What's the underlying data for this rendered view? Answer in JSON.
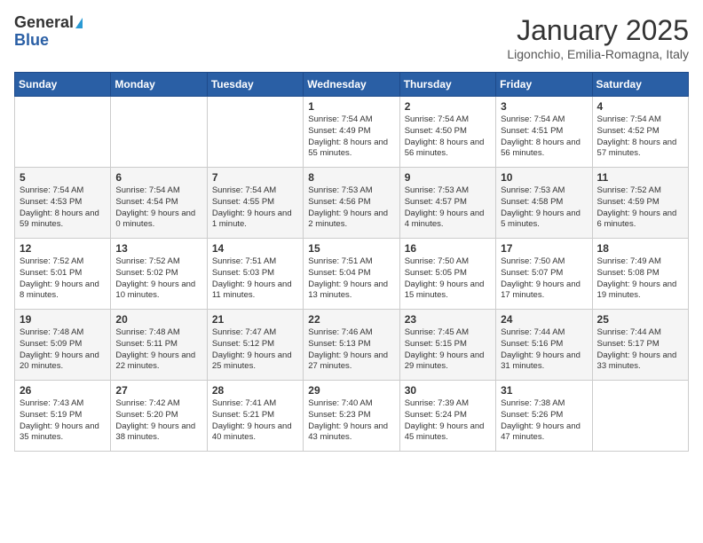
{
  "header": {
    "logo_general": "General",
    "logo_blue": "Blue",
    "month_title": "January 2025",
    "location": "Ligonchio, Emilia-Romagna, Italy"
  },
  "days_of_week": [
    "Sunday",
    "Monday",
    "Tuesday",
    "Wednesday",
    "Thursday",
    "Friday",
    "Saturday"
  ],
  "weeks": [
    [
      {
        "day": "",
        "content": ""
      },
      {
        "day": "",
        "content": ""
      },
      {
        "day": "",
        "content": ""
      },
      {
        "day": "1",
        "content": "Sunrise: 7:54 AM\nSunset: 4:49 PM\nDaylight: 8 hours and 55 minutes."
      },
      {
        "day": "2",
        "content": "Sunrise: 7:54 AM\nSunset: 4:50 PM\nDaylight: 8 hours and 56 minutes."
      },
      {
        "day": "3",
        "content": "Sunrise: 7:54 AM\nSunset: 4:51 PM\nDaylight: 8 hours and 56 minutes."
      },
      {
        "day": "4",
        "content": "Sunrise: 7:54 AM\nSunset: 4:52 PM\nDaylight: 8 hours and 57 minutes."
      }
    ],
    [
      {
        "day": "5",
        "content": "Sunrise: 7:54 AM\nSunset: 4:53 PM\nDaylight: 8 hours and 59 minutes."
      },
      {
        "day": "6",
        "content": "Sunrise: 7:54 AM\nSunset: 4:54 PM\nDaylight: 9 hours and 0 minutes."
      },
      {
        "day": "7",
        "content": "Sunrise: 7:54 AM\nSunset: 4:55 PM\nDaylight: 9 hours and 1 minute."
      },
      {
        "day": "8",
        "content": "Sunrise: 7:53 AM\nSunset: 4:56 PM\nDaylight: 9 hours and 2 minutes."
      },
      {
        "day": "9",
        "content": "Sunrise: 7:53 AM\nSunset: 4:57 PM\nDaylight: 9 hours and 4 minutes."
      },
      {
        "day": "10",
        "content": "Sunrise: 7:53 AM\nSunset: 4:58 PM\nDaylight: 9 hours and 5 minutes."
      },
      {
        "day": "11",
        "content": "Sunrise: 7:52 AM\nSunset: 4:59 PM\nDaylight: 9 hours and 6 minutes."
      }
    ],
    [
      {
        "day": "12",
        "content": "Sunrise: 7:52 AM\nSunset: 5:01 PM\nDaylight: 9 hours and 8 minutes."
      },
      {
        "day": "13",
        "content": "Sunrise: 7:52 AM\nSunset: 5:02 PM\nDaylight: 9 hours and 10 minutes."
      },
      {
        "day": "14",
        "content": "Sunrise: 7:51 AM\nSunset: 5:03 PM\nDaylight: 9 hours and 11 minutes."
      },
      {
        "day": "15",
        "content": "Sunrise: 7:51 AM\nSunset: 5:04 PM\nDaylight: 9 hours and 13 minutes."
      },
      {
        "day": "16",
        "content": "Sunrise: 7:50 AM\nSunset: 5:05 PM\nDaylight: 9 hours and 15 minutes."
      },
      {
        "day": "17",
        "content": "Sunrise: 7:50 AM\nSunset: 5:07 PM\nDaylight: 9 hours and 17 minutes."
      },
      {
        "day": "18",
        "content": "Sunrise: 7:49 AM\nSunset: 5:08 PM\nDaylight: 9 hours and 19 minutes."
      }
    ],
    [
      {
        "day": "19",
        "content": "Sunrise: 7:48 AM\nSunset: 5:09 PM\nDaylight: 9 hours and 20 minutes."
      },
      {
        "day": "20",
        "content": "Sunrise: 7:48 AM\nSunset: 5:11 PM\nDaylight: 9 hours and 22 minutes."
      },
      {
        "day": "21",
        "content": "Sunrise: 7:47 AM\nSunset: 5:12 PM\nDaylight: 9 hours and 25 minutes."
      },
      {
        "day": "22",
        "content": "Sunrise: 7:46 AM\nSunset: 5:13 PM\nDaylight: 9 hours and 27 minutes."
      },
      {
        "day": "23",
        "content": "Sunrise: 7:45 AM\nSunset: 5:15 PM\nDaylight: 9 hours and 29 minutes."
      },
      {
        "day": "24",
        "content": "Sunrise: 7:44 AM\nSunset: 5:16 PM\nDaylight: 9 hours and 31 minutes."
      },
      {
        "day": "25",
        "content": "Sunrise: 7:44 AM\nSunset: 5:17 PM\nDaylight: 9 hours and 33 minutes."
      }
    ],
    [
      {
        "day": "26",
        "content": "Sunrise: 7:43 AM\nSunset: 5:19 PM\nDaylight: 9 hours and 35 minutes."
      },
      {
        "day": "27",
        "content": "Sunrise: 7:42 AM\nSunset: 5:20 PM\nDaylight: 9 hours and 38 minutes."
      },
      {
        "day": "28",
        "content": "Sunrise: 7:41 AM\nSunset: 5:21 PM\nDaylight: 9 hours and 40 minutes."
      },
      {
        "day": "29",
        "content": "Sunrise: 7:40 AM\nSunset: 5:23 PM\nDaylight: 9 hours and 43 minutes."
      },
      {
        "day": "30",
        "content": "Sunrise: 7:39 AM\nSunset: 5:24 PM\nDaylight: 9 hours and 45 minutes."
      },
      {
        "day": "31",
        "content": "Sunrise: 7:38 AM\nSunset: 5:26 PM\nDaylight: 9 hours and 47 minutes."
      },
      {
        "day": "",
        "content": ""
      }
    ]
  ]
}
